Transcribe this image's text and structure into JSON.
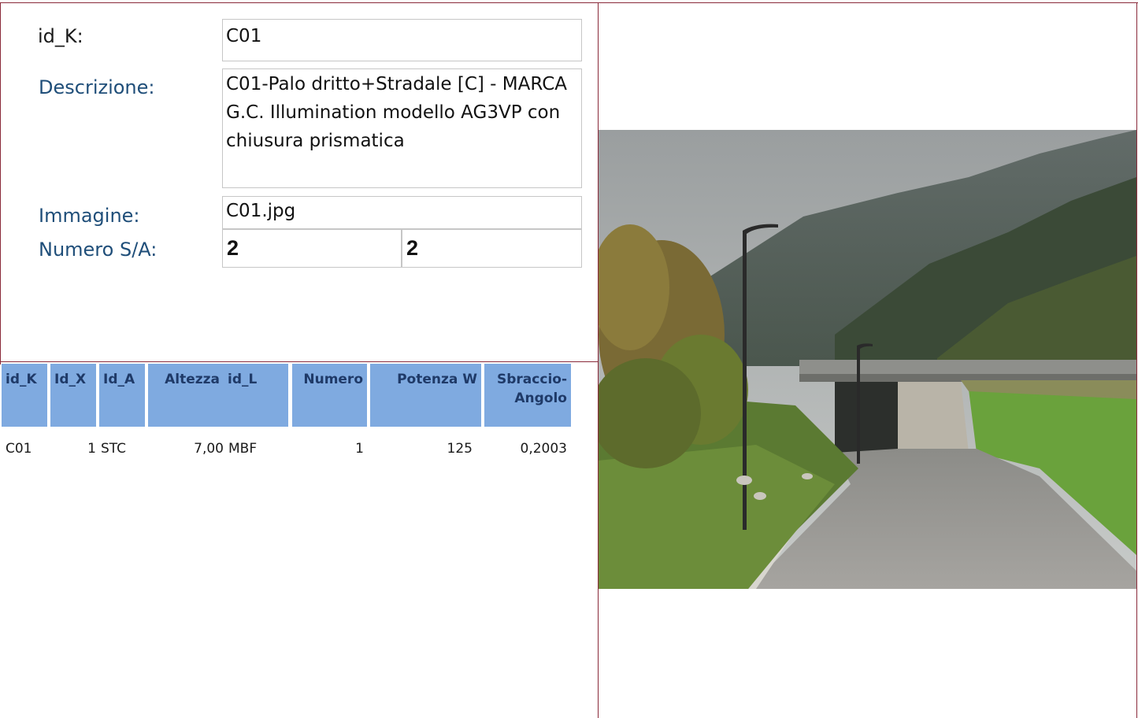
{
  "form": {
    "id_k_label": "id_K:",
    "id_k_value": "C01",
    "descrizione_label": "Descrizione:",
    "descrizione_value": "C01-Palo dritto+Stradale [C] - MARCA G.C. Illumination modello AG3VP con chiusura prismatica",
    "immagine_label": "Immagine:",
    "immagine_value": "C01.jpg",
    "numero_sa_label": "Numero S/A:",
    "numero_s_value": "2",
    "numero_a_value": "2"
  },
  "table": {
    "headers": [
      "id_K",
      "Id_X",
      "Id_A",
      "Altezza",
      "id_L",
      "Numero",
      "Potenza W",
      "Sbraccio-Angolo"
    ],
    "rows": [
      [
        "C01",
        "1",
        "STC",
        "7,00",
        "MBF",
        "1",
        "125",
        "0,2003"
      ]
    ]
  },
  "photo": {
    "subject": "street-light-photo"
  },
  "colors": {
    "frame": "#8a2a3a",
    "label_blue": "#1f4e79",
    "header_bg": "#7faae0",
    "header_text": "#1f3a68"
  }
}
